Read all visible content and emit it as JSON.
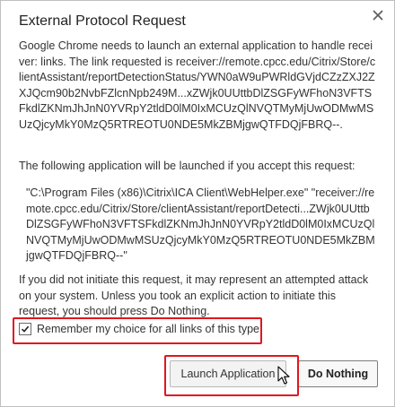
{
  "dialog": {
    "title": "External Protocol Request",
    "intro": "Google Chrome needs to launch an external application to handle receiver: links. The link requested is receiver://remote.cpcc.edu/Citrix/Store/clientAssistant/reportDetectionStatus/YWN0aW9uPWRldGVjdCZzZXJ2ZXJQcm90b2NvbFZlcnNpb249M...xZWjk0UUttbDlZSGFyWFhoN3VFTSFkdlZKNmJhJnN0YVRpY2tldD0lM0IxMCUzQlNVQTMyMjUwODMwMSUzQjcyMkY0MzQ5RTREOTU0NDE5MkZBMjgwQTFDQjFBRQ--.",
    "app_intro": "The following application will be launched if you accept this request:",
    "command": "\"C:\\Program Files (x86)\\Citrix\\ICA Client\\WebHelper.exe\" \"receiver://remote.cpcc.edu/Citrix/Store/clientAssistant/reportDetecti...ZWjk0UUttbDlZSGFyWFhoN3VFTSFkdlZKNmJhJnN0YVRpY2tldD0lM0IxMCUzQlNVQTMyMjUwODMwMSUzQjcyMkY0MzQ5RTREOTU0NDE5MkZBMjgwQTFDQjFBRQ--\"",
    "warning": "If you did not initiate this request, it may represent an attempted attack on your system. Unless you took an explicit action to initiate this request, you should press Do Nothing.",
    "checkbox_label": "Remember my choice for all links of this type.",
    "checkbox_checked": true,
    "launch_label": "Launch Application",
    "do_nothing_label": "Do Nothing",
    "close_icon": "close-icon",
    "highlight_color": "#e0161e"
  }
}
